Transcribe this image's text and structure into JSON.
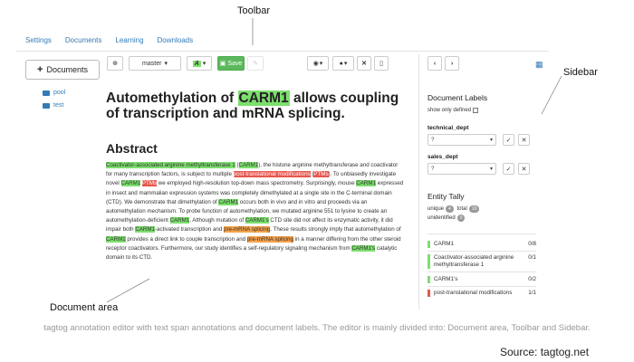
{
  "callouts": {
    "toolbar": "Toolbar",
    "sidebar": "Sidebar",
    "document_area": "Document area"
  },
  "nav": {
    "items": [
      "Settings",
      "Documents",
      "Learning",
      "Downloads"
    ]
  },
  "left": {
    "add_docs_label": "Documents",
    "folders": [
      "pool",
      "test"
    ]
  },
  "toolbar": {
    "project": "master",
    "save": "Save"
  },
  "document": {
    "title_before": "Automethylation of ",
    "title_entity": "CARM1",
    "title_after": " allows coupling of transcription and mRNA splicing.",
    "abstract_heading": "Abstract",
    "abstract_segments": [
      {
        "t": "Coactivator-associated arginine methyltransferase 1",
        "a": "g"
      },
      {
        "t": " (",
        "a": ""
      },
      {
        "t": "CARM1",
        "a": "g"
      },
      {
        "t": "), the histone arginine methyltransferase and coactivator for many transcription factors, is subject to multiple ",
        "a": ""
      },
      {
        "t": "post-translational modifications",
        "a": "r"
      },
      {
        "t": " (",
        "a": ""
      },
      {
        "t": "PTMs",
        "a": "r"
      },
      {
        "t": "). To unbiasedly investigate novel ",
        "a": ""
      },
      {
        "t": "CARM1",
        "a": "g"
      },
      {
        "t": " ",
        "a": ""
      },
      {
        "t": "PTMs",
        "a": "r"
      },
      {
        "t": " we employed high-resolution top-down mass spectrometry. Surprisingly, mouse ",
        "a": ""
      },
      {
        "t": "CARM1",
        "a": "g"
      },
      {
        "t": " expressed in insect and mammalian expression systems was completely dimethylated at a single site in the C-terminal domain (CTD). We demonstrate that dimethylation of ",
        "a": ""
      },
      {
        "t": "CARM1",
        "a": "g"
      },
      {
        "t": " occurs both in vivo and in vitro and proceeds via an automethylation mechanism. To probe function of automethylation, we mutated arginine 551 to lysine to create an automethylation-deficient ",
        "a": ""
      },
      {
        "t": "CARM1",
        "a": "g"
      },
      {
        "t": ". Although mutation of ",
        "a": ""
      },
      {
        "t": "CARM1's",
        "a": "g"
      },
      {
        "t": " CTD site did not affect its enzymatic activity, it did impair both ",
        "a": ""
      },
      {
        "t": "CARM1",
        "a": "g"
      },
      {
        "t": "-activated transcription and ",
        "a": ""
      },
      {
        "t": "pre-mRNA splicing",
        "a": "o"
      },
      {
        "t": ". These results strongly imply that automethylation of ",
        "a": ""
      },
      {
        "t": "CARM1",
        "a": "g"
      },
      {
        "t": " provides a direct link to couple transcription and ",
        "a": ""
      },
      {
        "t": "pre-mRNA splicing",
        "a": "o"
      },
      {
        "t": " in a manner differing from the other steroid receptor coactivators. Furthermore, our study identifies a self-regulatory signaling mechanism from ",
        "a": ""
      },
      {
        "t": "CARM1's",
        "a": "g"
      },
      {
        "t": " catalytic domain to its CTD.",
        "a": ""
      }
    ]
  },
  "sidebar": {
    "doc_labels_heading": "Document Labels",
    "show_only_defined": "show only defined",
    "label1": "technical_dept",
    "label1_value": "?",
    "label2": "sales_dept",
    "label2_value": "?",
    "tally_heading": "Entity Tally",
    "unique_label": "unique",
    "unique_count": "4",
    "total_label": "total",
    "total_count": "10",
    "unidentified_label": "unidentified",
    "unidentified_count": "0",
    "tally": [
      {
        "name": "CARM1",
        "value": "0/8",
        "color": "#7dde6e"
      },
      {
        "name": "Coactivator-associated arginine methyltransferase 1",
        "value": "0/1",
        "color": "#7dde6e"
      },
      {
        "name": "CARM1's",
        "value": "0/2",
        "color": "#7dde6e"
      },
      {
        "name": "post-translational modifications",
        "value": "1/1",
        "color": "#e8564e"
      }
    ]
  },
  "caption": "tagtog annotation editor with text span annotations and document labels. The editor is mainly divided into: Document area, Toolbar and Sidebar.",
  "source": "Source: tagtog.net"
}
